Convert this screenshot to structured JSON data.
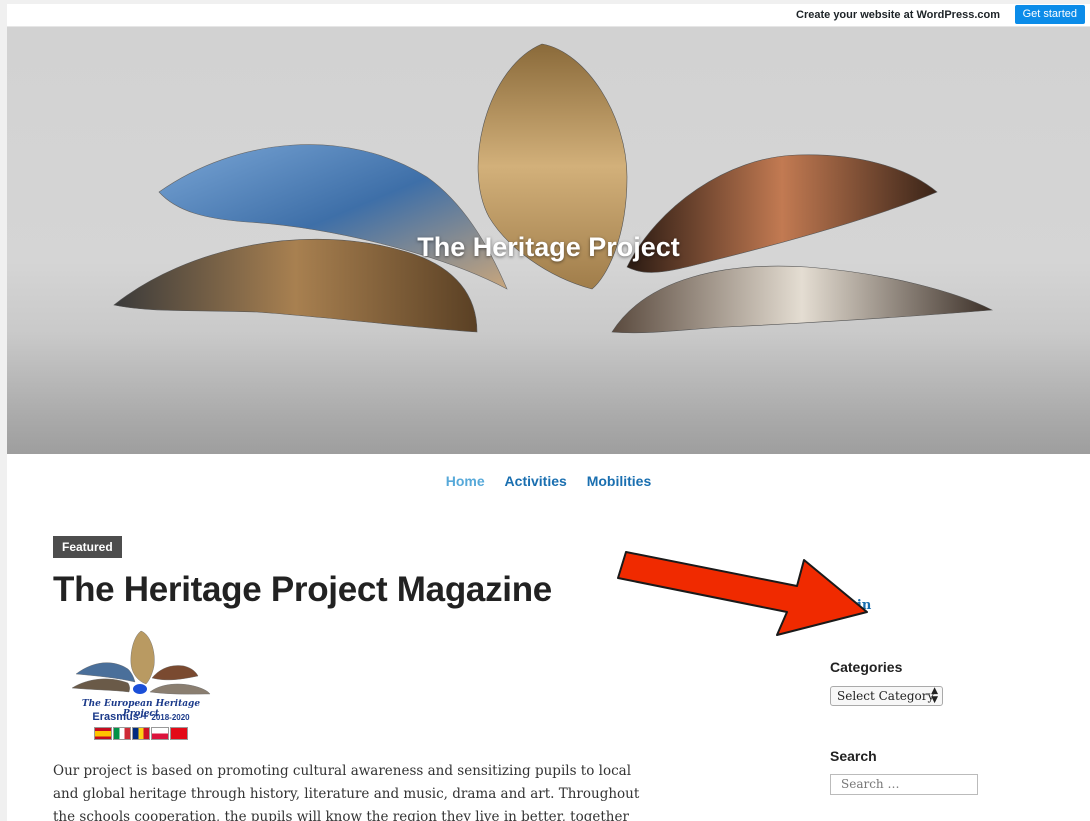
{
  "wpbar": {
    "create_text": "Create your website at WordPress.com",
    "cta_label": "Get started"
  },
  "site": {
    "title": "The Heritage Project"
  },
  "nav": {
    "items": [
      {
        "label": "Home",
        "current": true
      },
      {
        "label": "Activities",
        "current": false
      },
      {
        "label": "Mobilities",
        "current": false
      }
    ]
  },
  "post": {
    "badge": "Featured",
    "title": "The Heritage Project Magazine",
    "logo_line1": "The European Heritage Project",
    "logo_program": "Erasmus +",
    "logo_years": "2018-2020",
    "text": "Our project is based on promoting cultural awareness and sensitizing pupils to local and global heritage through history, literature and music, drama and art. Throughout the schools cooperation, the pupils will know the region they live in better, together with"
  },
  "sidebar": {
    "login_label": "Login",
    "categories_title": "Categories",
    "categories_selected": "Select Category",
    "search_title": "Search",
    "search_placeholder": "Search …"
  },
  "colors": {
    "link": "#1a6fb0",
    "nav_current": "#57a9d9",
    "cta": "#0b8ce9",
    "annotation_arrow": "#f02a00"
  },
  "icons": [
    "select-arrows-icon",
    "red-arrow-annotation"
  ]
}
